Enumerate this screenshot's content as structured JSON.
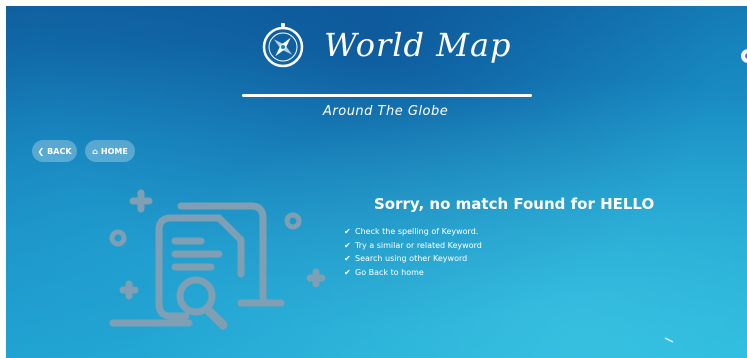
{
  "header": {
    "title": "World Map",
    "subtitle": "Around The Globe"
  },
  "nav": {
    "back_label": "BACK",
    "back_icon": "chevron-left-icon",
    "home_label": "HOME",
    "home_icon": "home-icon"
  },
  "message": {
    "title": "Sorry, no match Found for HELLO",
    "tips": [
      "Check the spelling of Keyword.",
      "Try a similar or related Keyword",
      "Search using other Keyword",
      "Go Back to home"
    ],
    "tip_icon": "checkmark-icon"
  },
  "illustration": {
    "icon": "document-search-icon",
    "color": "#7f9fb4"
  },
  "colors": {
    "background_top": "#0f5f9e",
    "background_bottom": "#27b7dc",
    "text": "#ffffff",
    "button_bg": "rgba(255,255,255,0.28)"
  }
}
